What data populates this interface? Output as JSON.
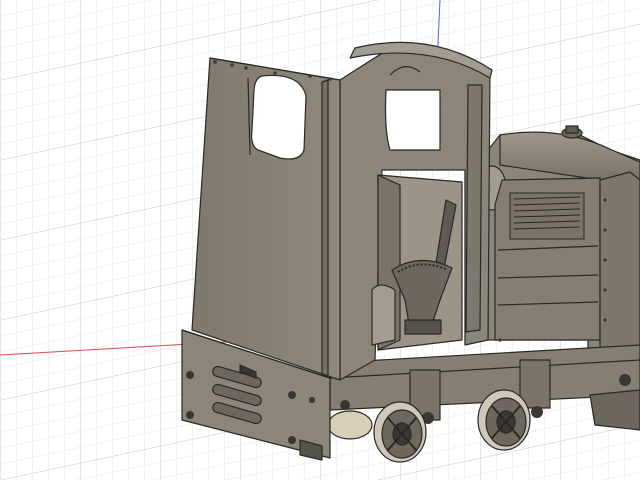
{
  "viewport": {
    "background": "#ffffff",
    "grid_minor_color": "#e3e6ea",
    "grid_major_color": "#c9ced6",
    "x_axis_color": "#e04a4a",
    "z_axis_color": "#4a64e0"
  },
  "model": {
    "body_color": "#8c8579",
    "body_dark": "#6d675e",
    "body_light": "#a39c90",
    "edge_color": "#2a2826",
    "wheel_color": "#cfc8b8",
    "icons": [
      "locomotive-model-icon",
      "wheel-icon",
      "lever-icon"
    ]
  }
}
